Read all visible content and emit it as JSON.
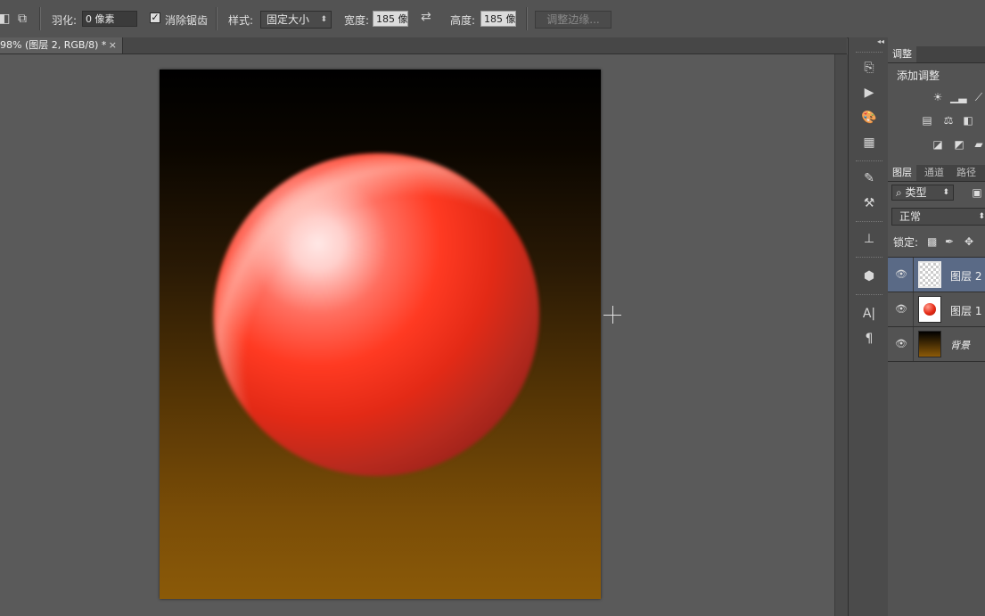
{
  "options_bar": {
    "feather_label": "羽化:",
    "feather_value": "0 像素",
    "antialias_label": "消除锯齿",
    "antialias_checked": true,
    "style_label": "样式:",
    "style_value": "固定大小",
    "width_label": "宽度:",
    "width_value": "185 像",
    "height_label": "高度:",
    "height_value": "185 像",
    "refine_edge_button": "调整边缘..."
  },
  "document_tab": {
    "title": "98% (图层 2, RGB/8) *",
    "close": "×"
  },
  "canvas": {
    "gradient_top": "#000000",
    "gradient_bottom": "#8b5a08",
    "ball_color": "#e32a16"
  },
  "adjustments_panel": {
    "tab": "调整",
    "add_adjustment": "添加调整"
  },
  "layers_panel": {
    "tabs": [
      "图层",
      "通道",
      "路径"
    ],
    "filter_kind": "类型",
    "blend_mode": "正常",
    "lock_label": "锁定:",
    "layers": [
      {
        "name": "图层 2",
        "selected": true
      },
      {
        "name": "图层 1",
        "selected": false
      },
      {
        "name": "背景",
        "selected": false
      }
    ]
  },
  "colors": {
    "selected_layer": "#5a6a86",
    "panel_bg": "#535353"
  }
}
